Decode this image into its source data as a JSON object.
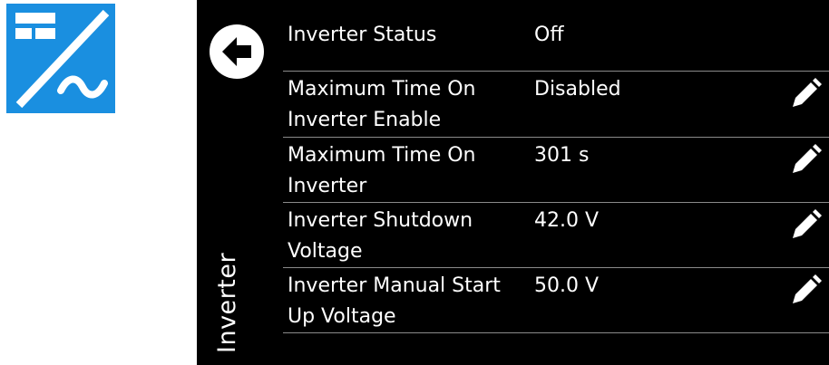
{
  "app": {
    "icon": "inverter-dc-ac-icon",
    "icon_color": "#1a8fe0",
    "screen_background": "#000000",
    "text_color": "#ffffff"
  },
  "screen": {
    "title": "Inverter",
    "back_icon": "back-arrow-icon"
  },
  "settings": [
    {
      "label": "Inverter Status",
      "value": "Off",
      "editable": false
    },
    {
      "label": "Maximum Time On\nInverter Enable",
      "value": "Disabled",
      "editable": true,
      "edit_icon": "pencil-icon"
    },
    {
      "label": "Maximum Time On\nInverter",
      "value": "301 s",
      "editable": true,
      "edit_icon": "pencil-icon"
    },
    {
      "label": "Inverter Shutdown\nVoltage",
      "value": "42.0 V",
      "editable": true,
      "edit_icon": "pencil-icon"
    },
    {
      "label": "Inverter Manual Start\nUp Voltage",
      "value": "50.0 V",
      "editable": true,
      "edit_icon": "pencil-icon"
    }
  ]
}
